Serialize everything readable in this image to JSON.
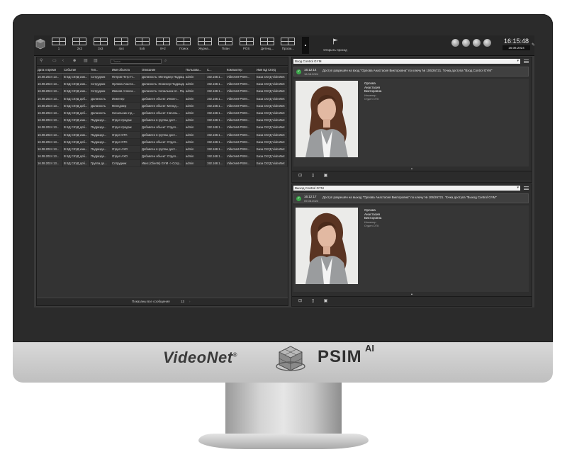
{
  "brand": {
    "videonet": "VideoNet",
    "registered": "®",
    "psim": "PSIM",
    "ai": "AI"
  },
  "topbar": {
    "layouts": [
      "1",
      "2x2",
      "3x3",
      "4x4",
      "5x5",
      "8+2",
      "Поиск",
      "Журна...",
      "План",
      "POS",
      "Детекц...",
      "Просм..."
    ],
    "open_passage": "Открыть проход",
    "time": "16:15:48",
    "date": "16.08.2024"
  },
  "journal": {
    "search_placeholder": "Поиск",
    "columns": [
      "Дата и время",
      "Событие",
      "Тип...",
      "Имя объекта",
      "Описание",
      "Пользова...",
      "С...",
      "Компьютер",
      "Имя БД СКУД"
    ],
    "rows": [
      [
        "16.08.2024 13...",
        "В БД СКУД изм...",
        "Сотрудник",
        "Петров Петр П...",
        "Должность: Менеджер Подразделение: Отдел пр...",
        "admin",
        "192.168.1...",
        "VideoNet-PSIM...",
        "База СКУД VideoNet"
      ],
      [
        "16.08.2024 13...",
        "В БД СКУД изм...",
        "Сотрудник",
        "Орлова Анаста...",
        "Должность: Инженер Подразделение: Отдел ОТК",
        "admin",
        "192.168.1...",
        "VideoNet-PSIM...",
        "База СКУД VideoNet"
      ],
      [
        "16.08.2024 13...",
        "В БД СКУД изм...",
        "Сотрудник",
        "Иванов Алекса...",
        "Должность: Начальник от... Подразделение: Отдел АХО",
        "admin",
        "192.168.1...",
        "VideoNet-PSIM...",
        "База СКУД VideoNet"
      ],
      [
        "16.08.2024 13...",
        "В БД СКУД доб...",
        "Должность",
        "Инженер",
        "Добавлен объект: Инжен...",
        "admin",
        "192.168.1...",
        "VideoNet-PSIM...",
        "База СКУД VideoNet"
      ],
      [
        "16.08.2024 13...",
        "В БД СКУД доб...",
        "Должность",
        "Менеджер",
        "Добавлен объект: Менед...",
        "admin",
        "192.168.1...",
        "VideoNet-PSIM...",
        "База СКУД VideoNet"
      ],
      [
        "16.08.2024 13...",
        "В БД СКУД доб...",
        "Должность",
        "Начальник отд...",
        "Добавлен объект: Началь...",
        "admin",
        "192.168.1...",
        "VideoNet-PSIM...",
        "База СКУД VideoNet"
      ],
      [
        "16.08.2024 13...",
        "В БД СКУД изм...",
        "Подразде...",
        "Отдел продаж",
        "Добавлен в группы дост...",
        "admin",
        "192.168.1...",
        "VideoNet-PSIM...",
        "База СКУД VideoNet"
      ],
      [
        "16.08.2024 13...",
        "В БД СКУД доб...",
        "Подразде...",
        "Отдел продаж",
        "Добавлен объект: Отдел...",
        "admin",
        "192.168.1...",
        "VideoNet-PSIM...",
        "База СКУД VideoNet"
      ],
      [
        "16.08.2024 13...",
        "В БД СКУД изм...",
        "Подразде...",
        "Отдел ОТК",
        "Добавлен в группы дост...",
        "admin",
        "192.168.1...",
        "VideoNet-PSIM...",
        "База СКУД VideoNet"
      ],
      [
        "16.08.2024 13...",
        "В БД СКУД доб...",
        "Подразде...",
        "Отдел ОТК",
        "Добавлен объект: Отдел...",
        "admin",
        "192.168.1...",
        "VideoNet-PSIM...",
        "База СКУД VideoNet"
      ],
      [
        "16.08.2024 13...",
        "В БД СКУД изм...",
        "Подразде...",
        "Отдел АХО",
        "Добавлен в группы дост...",
        "admin",
        "192.168.1...",
        "VideoNet-PSIM...",
        "База СКУД VideoNet"
      ],
      [
        "16.08.2024 13...",
        "В БД СКУД доб...",
        "Подразде...",
        "Отдел АХО",
        "Добавлен объект: Отдел...",
        "admin",
        "192.168.1...",
        "VideoNet-PSIM...",
        "База СКУД VideoNet"
      ],
      [
        "16.08.2024 13...",
        "В БД СКУД доб...",
        "Группа до...",
        "Сотрудник",
        "Ивис (Clients) GYM -> Сотр...",
        "admin",
        "192.168.1...",
        "VideoNet-PSIM...",
        "База СКУД VideoNet"
      ]
    ],
    "footer_text": "Показаны все сообщения",
    "footer_count": "13"
  },
  "monitor1": {
    "point": "Вход Control GYM",
    "time": "16:12:14",
    "date": "16.08.2024",
    "event": "Доступ разрешён на вход \"Орлова Анастасия Викторовна\" по ключу № 106/26721. Точка доступа \"Вход Control GYM\"",
    "name": [
      "Орлова",
      "Анастасия",
      "Викторовна"
    ],
    "position": "Инженер",
    "department": "Отдел ОТК"
  },
  "monitor2": {
    "point": "Выход Control GYM",
    "time": "16:12:17",
    "date": "09.08.2024",
    "event": "Доступ разрешён на выход \"Орлова Анастасия Викторовна\" по ключу № 106/26721. Точка доступа \"Выход Control GYM\"",
    "name": [
      "Орлова",
      "Анастасия",
      "Викторовна"
    ],
    "position": "Инженер",
    "department": "Отдел ОТК"
  }
}
